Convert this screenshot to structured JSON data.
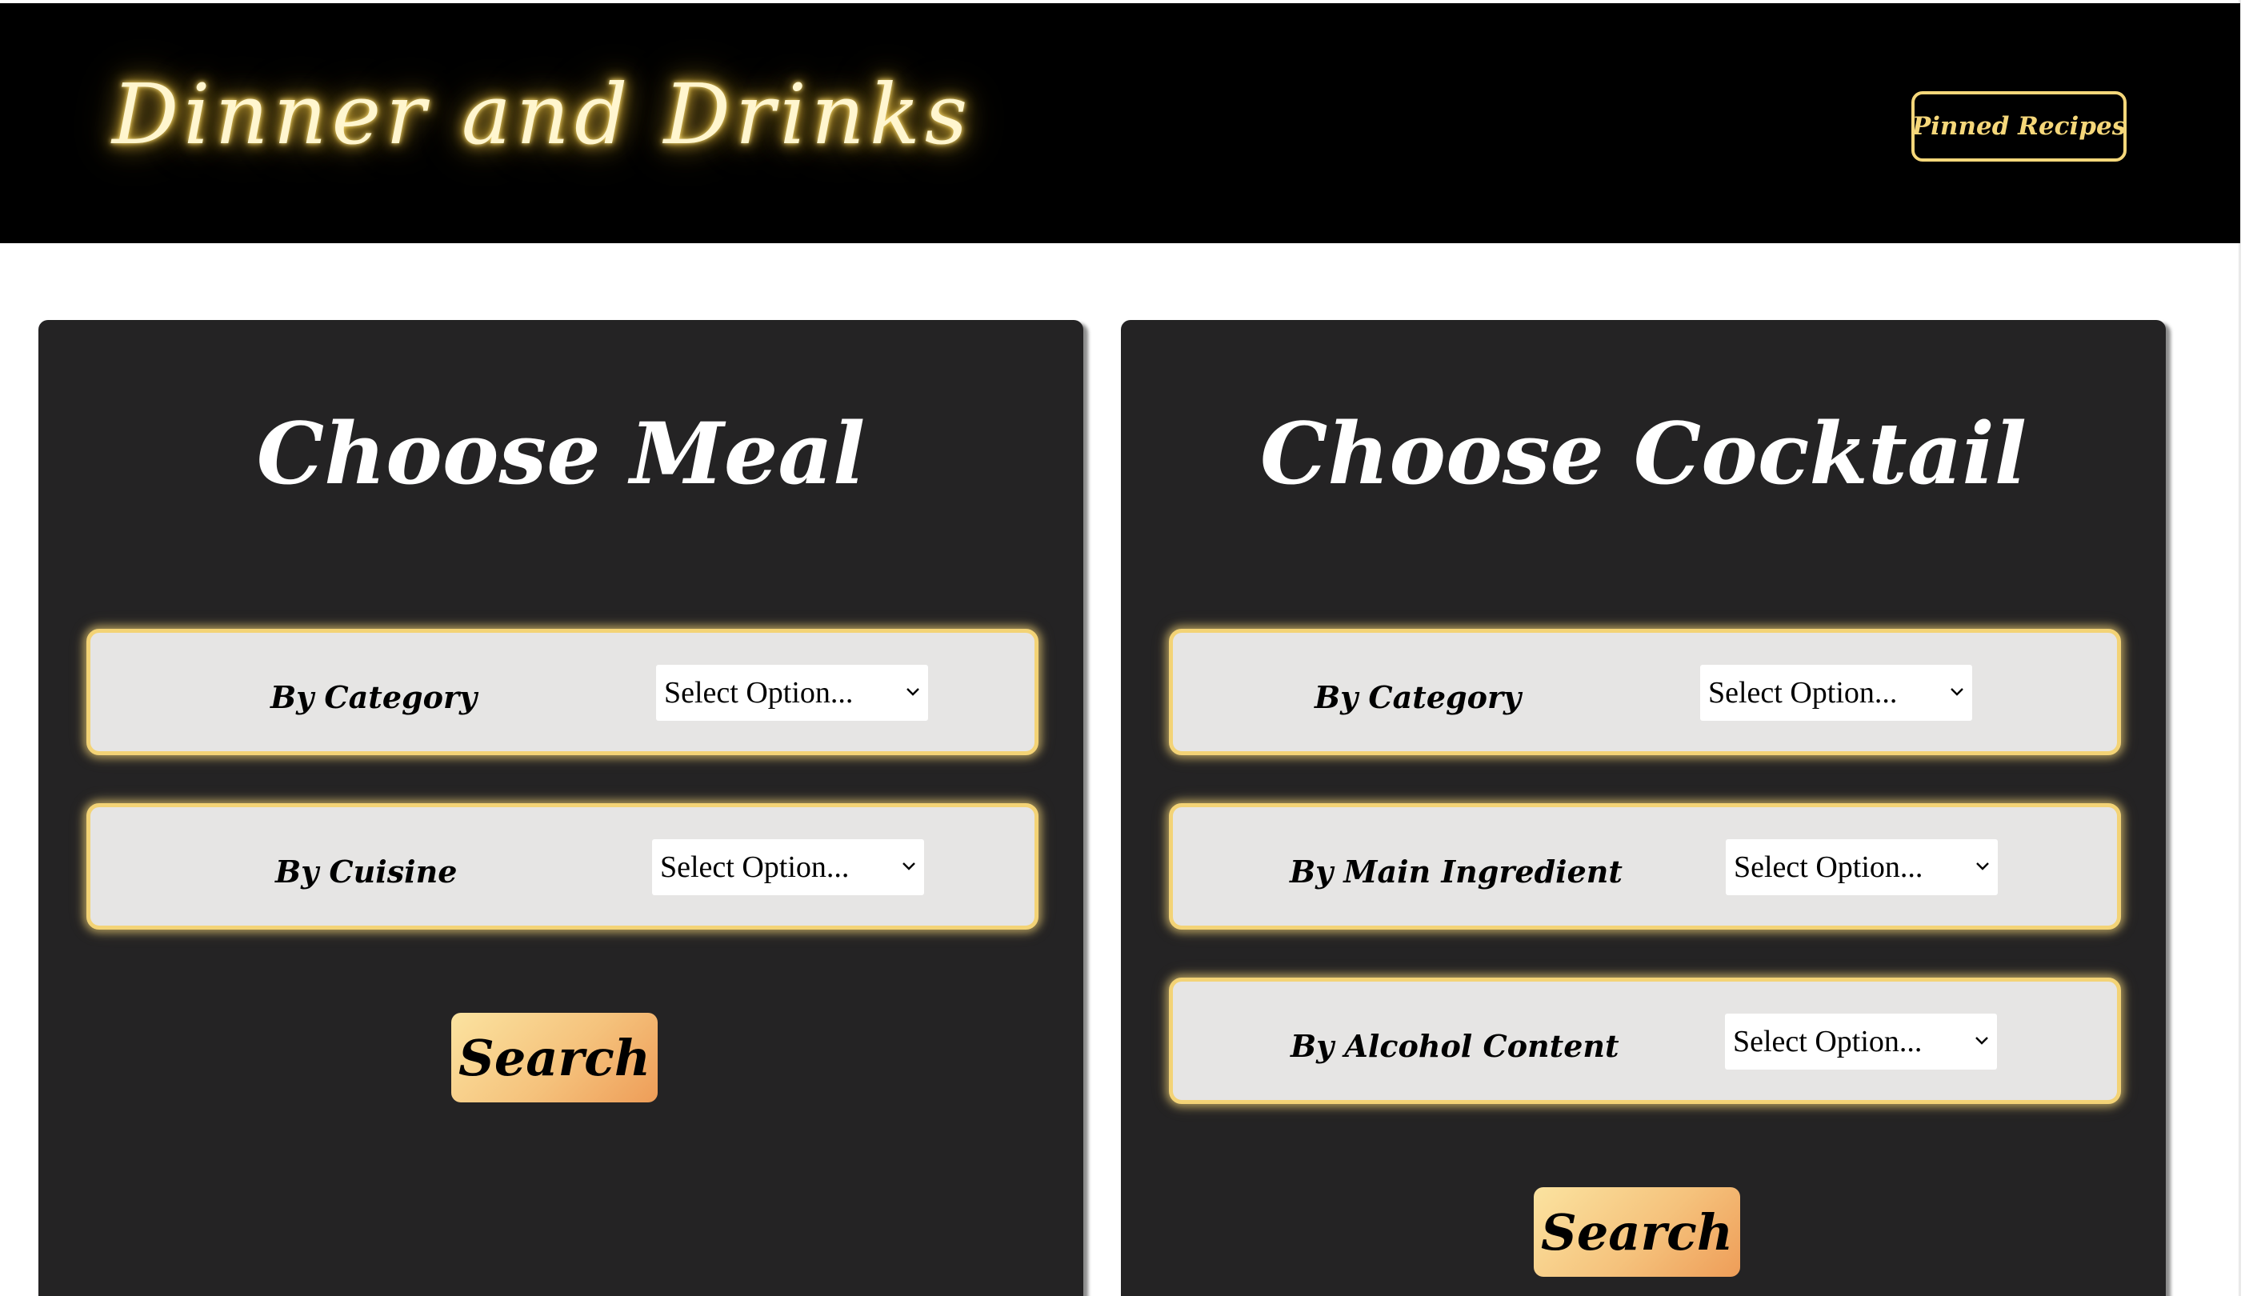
{
  "header": {
    "logo_text": "Dinner and Drinks",
    "pinned_label": "Pinned Recipes"
  },
  "meal": {
    "title": "Choose Meal",
    "filters": [
      {
        "label": "By Category",
        "value": "Select Option..."
      },
      {
        "label": "By Cuisine",
        "value": "Select Option..."
      }
    ],
    "search_label": "Search"
  },
  "cocktail": {
    "title": "Choose Cocktail",
    "filters": [
      {
        "label": "By Category",
        "value": "Select Option..."
      },
      {
        "label": "By Main Ingredient",
        "value": "Select Option..."
      },
      {
        "label": "By Alcohol Content",
        "value": "Select Option..."
      }
    ],
    "search_label": "Search"
  },
  "icons": {
    "dropdown": "chevron-down-icon"
  },
  "colors": {
    "header_bg": "#000000",
    "accent_gold": "#f5d77a",
    "panel_bg": "#242324",
    "filter_bg": "#e6e5e4",
    "button_gradient_start": "#fbe3a0",
    "button_gradient_end": "#ee9d58"
  }
}
